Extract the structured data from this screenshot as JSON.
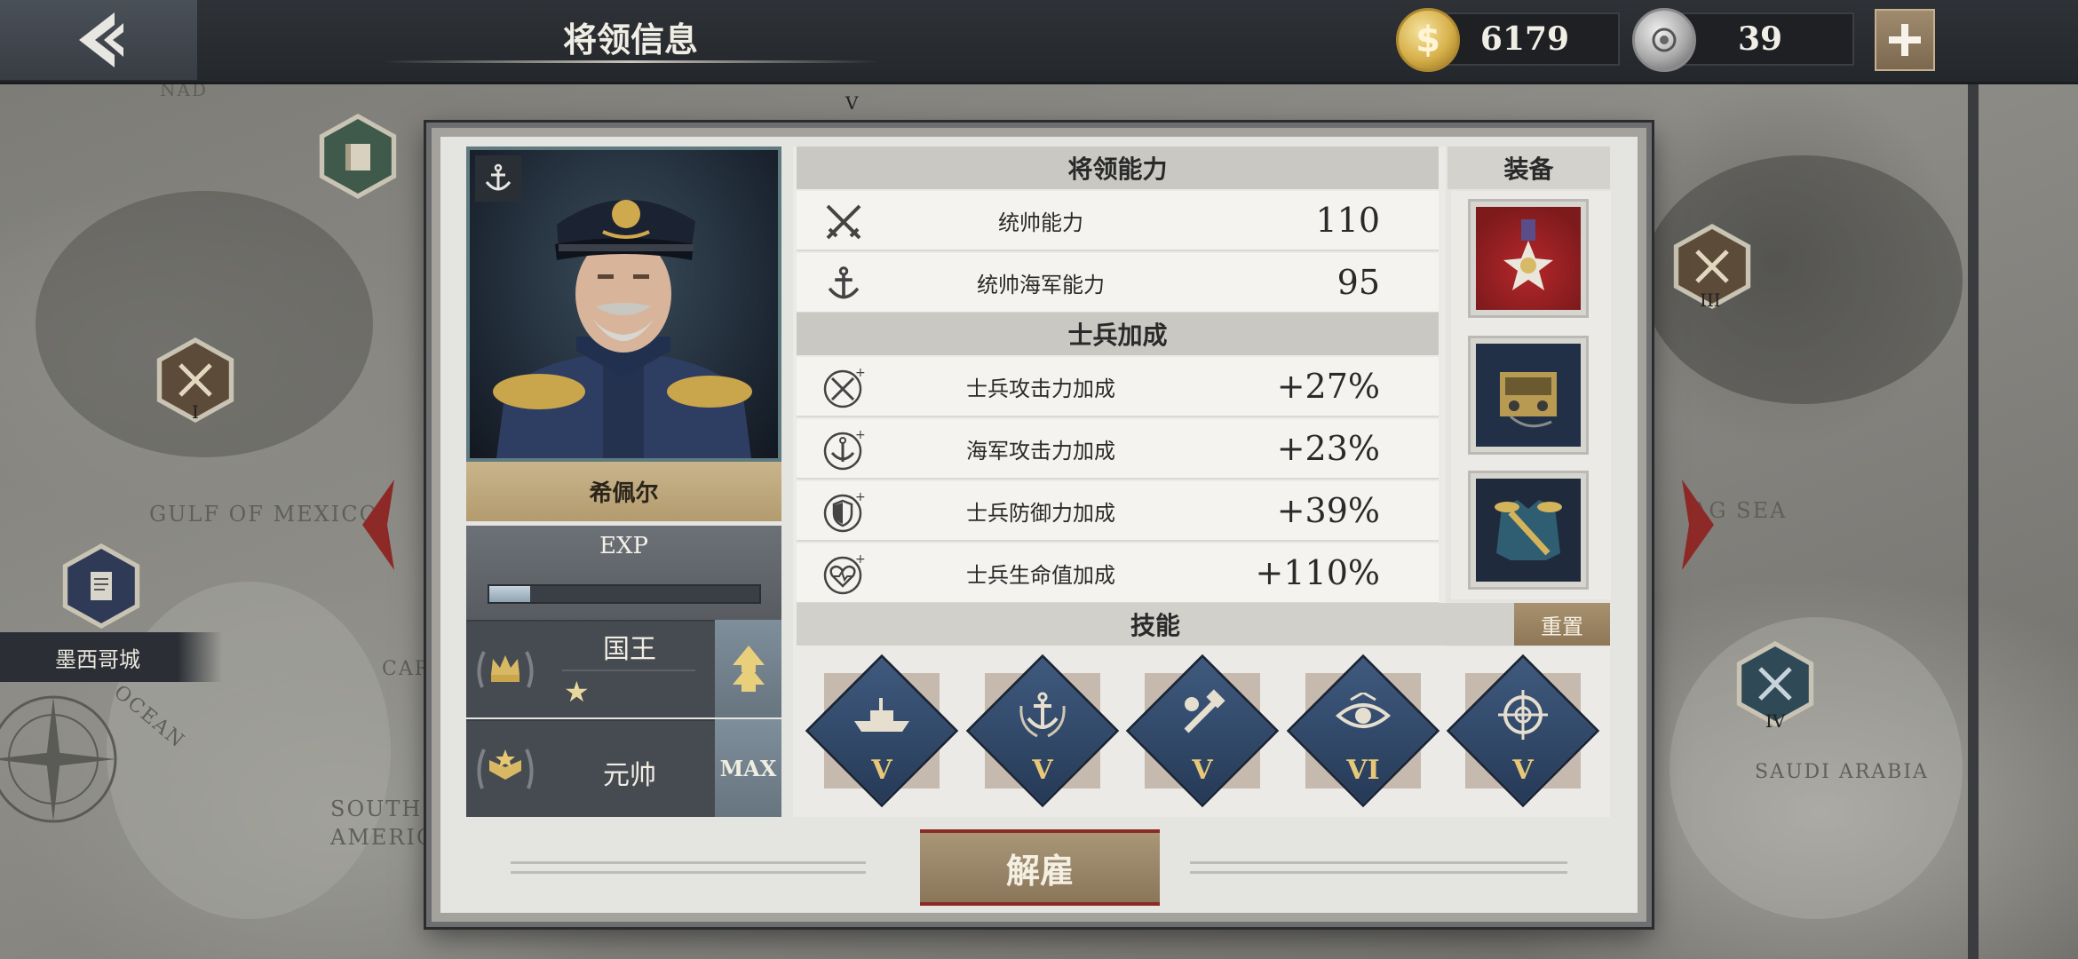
{
  "topbar": {
    "title": "将领信息",
    "gold": "6179",
    "medals": "39"
  },
  "map": {
    "labels": {
      "gulf": "GULF OF MEXICO",
      "south_america": "SOUTH AMERICA",
      "saudi": "SAUDI ARABIA",
      "sea": "AG SEA",
      "nada": "NAD",
      "ocean": "OCEAN",
      "car": "CAR"
    },
    "city": "墨西哥城",
    "nodes": [
      "I",
      "III",
      "IV",
      "V"
    ]
  },
  "general": {
    "name": "希佩尔",
    "exp_label": "EXP",
    "exp_progress": 0.15,
    "rank_title": "国王",
    "rank_stars": "★",
    "military_rank": "元帅",
    "max_label": "MAX"
  },
  "abilities": {
    "header": "将领能力",
    "rows": [
      {
        "label": "统帅能力",
        "value": "110",
        "icon": "crossed-swords-icon"
      },
      {
        "label": "统帅海军能力",
        "value": "95",
        "icon": "anchor-icon"
      }
    ]
  },
  "bonuses": {
    "header": "士兵加成",
    "rows": [
      {
        "label": "士兵攻击力加成",
        "value": "+27%",
        "icon": "attack-plus-icon"
      },
      {
        "label": "海军攻击力加成",
        "value": "+23%",
        "icon": "naval-attack-plus-icon"
      },
      {
        "label": "士兵防御力加成",
        "value": "+39%",
        "icon": "shield-plus-icon"
      },
      {
        "label": "士兵生命值加成",
        "value": "+110%",
        "icon": "heart-plus-icon"
      }
    ]
  },
  "equipment": {
    "header": "装备",
    "items": [
      "medal-icon",
      "radio-device-icon",
      "uniform-icon"
    ]
  },
  "skills": {
    "header": "技能",
    "reset_label": "重置",
    "items": [
      {
        "icon": "battleship-icon",
        "level": "V"
      },
      {
        "icon": "anchor-laurel-icon",
        "level": "V"
      },
      {
        "icon": "wrench-hammer-icon",
        "level": "V"
      },
      {
        "icon": "eye-icon",
        "level": "VI"
      },
      {
        "icon": "crosshair-icon",
        "level": "V"
      }
    ]
  },
  "actions": {
    "dismiss_label": "解雇"
  },
  "colors": {
    "accent_gold": "#e7c878",
    "skill_blue": "#2c4263",
    "dismiss_red": "#8c2a26"
  }
}
